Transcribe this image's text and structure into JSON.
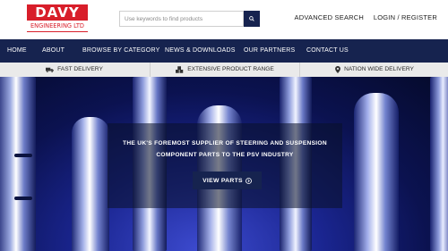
{
  "logo": {
    "name": "DAVY",
    "subtitle": "ENGINEERING LTD"
  },
  "search": {
    "placeholder": "Use keywords to find products"
  },
  "top_links": {
    "advanced_search": "ADVANCED SEARCH",
    "login_register": "LOGIN / REGISTER"
  },
  "nav": {
    "items": [
      "HOME",
      "ABOUT",
      "BROWSE BY CATEGORY",
      "NEWS & DOWNLOADS",
      "OUR PARTNERS",
      "CONTACT US"
    ]
  },
  "features": [
    {
      "label": "FAST DELIVERY",
      "icon": "truck-icon"
    },
    {
      "label": "EXTENSIVE PRODUCT RANGE",
      "icon": "cubes-icon"
    },
    {
      "label": "NATION WIDE DELIVERY",
      "icon": "map-pin-icon"
    }
  ],
  "hero": {
    "headline_line1": "THE UK'S FOREMOST SUPPLIER OF STEERING AND SUSPENSION",
    "headline_line2": "COMPONENT PARTS TO THE PSV INDUSTRY",
    "button_label": "VIEW PARTS"
  },
  "colors": {
    "brand_red": "#d81e2a",
    "navy": "#16234f",
    "feature_bar": "#eaeaea"
  }
}
